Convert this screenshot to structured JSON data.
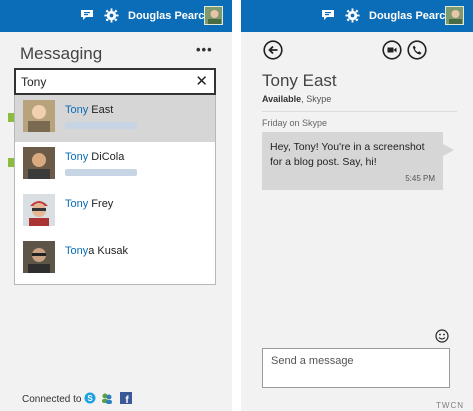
{
  "user": {
    "name": "Douglas Pearce"
  },
  "messaging": {
    "title": "Messaging",
    "search": {
      "value": "Tony",
      "placeholder": ""
    },
    "results": [
      {
        "highlight": "Tony",
        "rest": " East",
        "selected": true,
        "online": true
      },
      {
        "highlight": "Tony",
        "rest": " DiCola",
        "selected": false,
        "online": true
      },
      {
        "highlight": "Tony",
        "rest": " Frey",
        "selected": false,
        "online": false
      },
      {
        "highlight": "Tony",
        "rest": "a Kusak",
        "selected": false,
        "online": false
      }
    ],
    "connected_label": "Connected to"
  },
  "conversation": {
    "contact_name": "Tony East",
    "status_bold": "Available",
    "status_rest": ", Skype",
    "day_label": "Friday on Skype",
    "message_text": "Hey, Tony! You're in a screenshot for a blog post. Say, hi!",
    "message_time": "5:45 PM",
    "compose_placeholder": "Send a message"
  },
  "watermark": "TWCN",
  "icons": {
    "topbar": [
      "chat-icon",
      "gear-icon"
    ],
    "conversation_header": [
      "back-icon",
      "video-icon",
      "phone-icon"
    ],
    "connected_services": [
      "skype-icon",
      "messenger-icon",
      "facebook-icon"
    ]
  },
  "colors": {
    "topbar": "#0b6db7",
    "highlight": "#0b6db7",
    "presence": "#8cbc3c",
    "pane_bg": "#f2f2f2",
    "bubble": "#d6d6d6"
  }
}
